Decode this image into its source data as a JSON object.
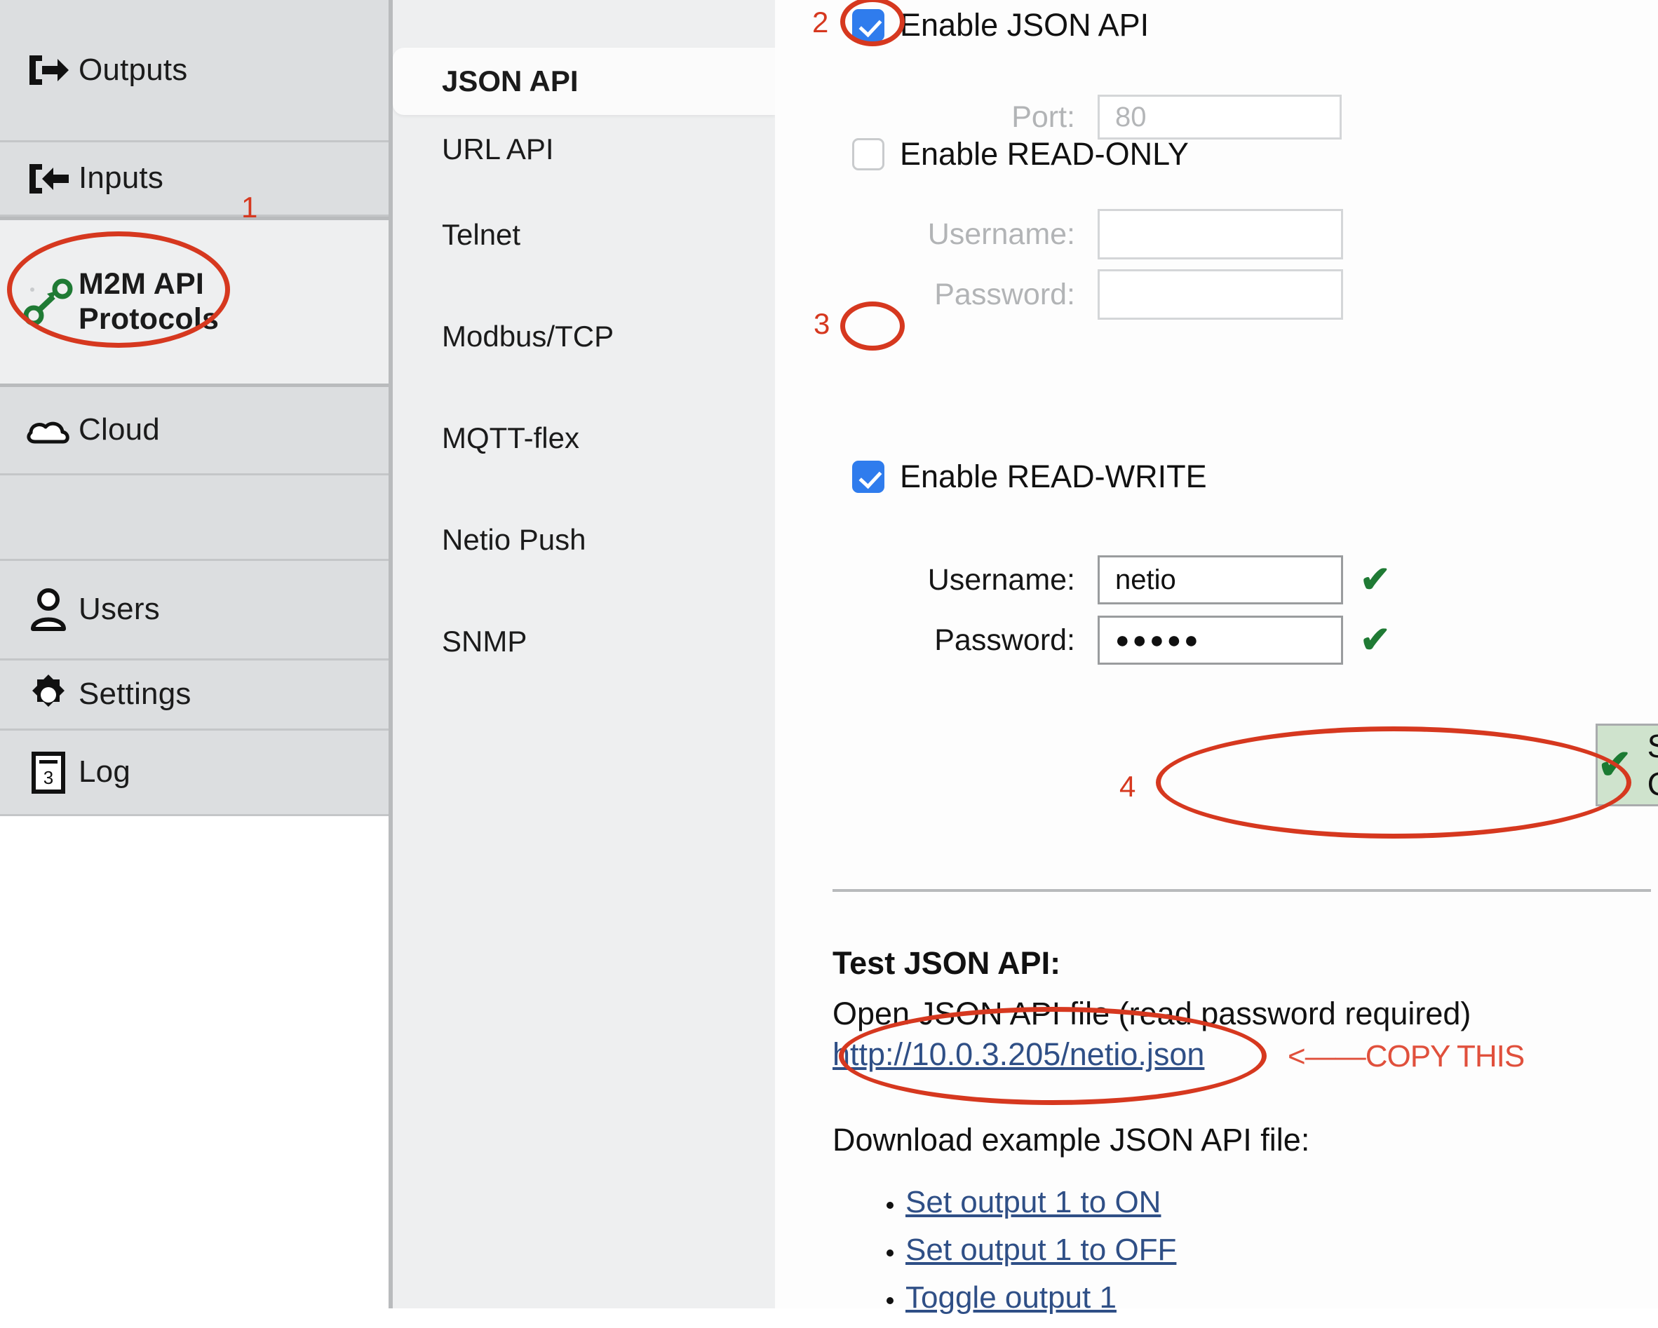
{
  "sidebar": {
    "items": [
      {
        "label": "Outputs",
        "icon": "output-arrow-icon",
        "state": "plain"
      },
      {
        "label": "Inputs",
        "icon": "input-arrow-icon",
        "state": "plain"
      },
      {
        "label": "M2M API Protocols",
        "icon": "m2m-nodes-icon",
        "state": "active"
      },
      {
        "label": "Cloud",
        "icon": "cloud-icon",
        "state": "plain"
      },
      {
        "label": "",
        "icon": "",
        "state": "blank"
      },
      {
        "label": "Users",
        "icon": "user-icon",
        "state": "plain"
      },
      {
        "label": "Settings",
        "icon": "gear-icon",
        "state": "plain"
      },
      {
        "label": "Log",
        "icon": "log-icon",
        "state": "plain"
      }
    ]
  },
  "protocols": {
    "items": [
      {
        "label": "JSON API",
        "selected": true
      },
      {
        "label": "URL API",
        "selected": false
      },
      {
        "label": "Telnet",
        "selected": false
      },
      {
        "label": "Modbus/TCP",
        "selected": false
      },
      {
        "label": "MQTT-flex",
        "selected": false
      },
      {
        "label": "Netio Push",
        "selected": false
      },
      {
        "label": "SNMP",
        "selected": false
      }
    ]
  },
  "form": {
    "enable_json_api": {
      "label": "Enable JSON API",
      "checked": true
    },
    "port": {
      "label": "Port:",
      "value": "80",
      "placeholder": "80",
      "disabled": true
    },
    "enable_read_only": {
      "label": "Enable READ-ONLY",
      "checked": false
    },
    "read_only": {
      "username_label": "Username:",
      "username_value": "",
      "password_label": "Password:",
      "password_value": ""
    },
    "enable_read_write": {
      "label": "Enable READ-WRITE",
      "checked": true
    },
    "read_write": {
      "username_label": "Username:",
      "username_value": "netio",
      "username_valid_mark": "✔",
      "password_label": "Password:",
      "password_value": "●●●●●",
      "password_valid_mark": "✔"
    },
    "save_button": {
      "label": "Save Changes",
      "icon_mark": "✔"
    }
  },
  "test_section": {
    "heading": "Test JSON API:",
    "open_file_text": "Open JSON API file (read password required)",
    "api_url": "http://10.0.3.205/netio.json",
    "download_heading": "Download example JSON API file:",
    "download_links": [
      "Set output 1 to ON",
      "Set output 1 to OFF",
      "Toggle output 1"
    ]
  },
  "annotations": {
    "marker_1": "1",
    "marker_2": "2",
    "marker_3": "3",
    "marker_4": "4",
    "copy_this": "<——COPY THIS",
    "highlight_color": "#d6381f"
  }
}
